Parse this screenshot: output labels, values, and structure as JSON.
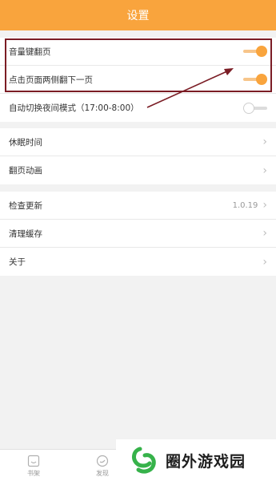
{
  "header": {
    "title": "设置"
  },
  "group1": {
    "rows": [
      {
        "label": "音量键翻页",
        "toggle": "on"
      },
      {
        "label": "点击页面两侧翻下一页",
        "toggle": "on"
      },
      {
        "label": "自动切换夜间模式（17:00-8:00）",
        "toggle": "off"
      }
    ]
  },
  "group2": {
    "rows": [
      {
        "label": "休眠时间"
      },
      {
        "label": "翻页动画"
      }
    ]
  },
  "group3": {
    "rows": [
      {
        "label": "检查更新",
        "value": "1.0.19"
      },
      {
        "label": "清理缓存"
      },
      {
        "label": "关于"
      }
    ]
  },
  "tabs": [
    {
      "label": "书架",
      "icon": "bookshelf-icon"
    },
    {
      "label": "发现",
      "icon": "discover-icon"
    }
  ],
  "watermark": {
    "text": "圈外游戏园"
  },
  "colors": {
    "accent": "#f9a43d",
    "annotation": "#7b1d25"
  }
}
